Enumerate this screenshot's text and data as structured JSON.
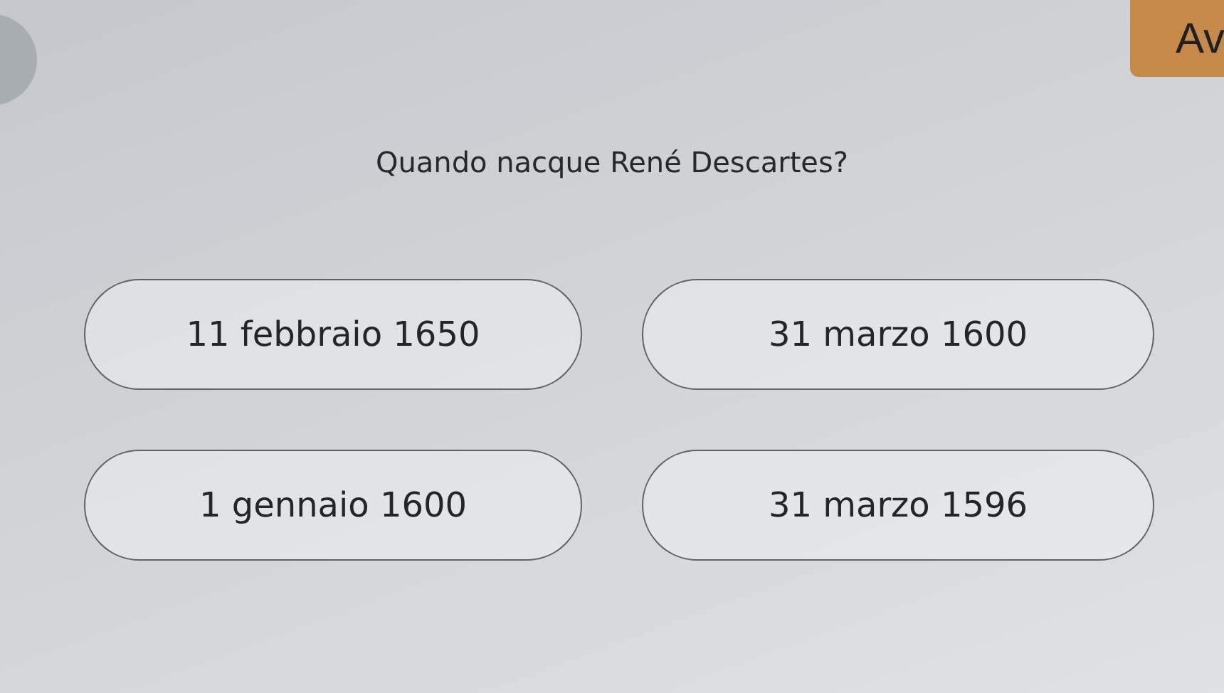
{
  "corner_button": {
    "label": "Av"
  },
  "question": "Quando nacque René Descartes?",
  "answers": [
    {
      "label": "11 febbraio 1650"
    },
    {
      "label": "31 marzo 1600"
    },
    {
      "label": "1 gennaio 1600"
    },
    {
      "label": "31 marzo 1596"
    }
  ]
}
